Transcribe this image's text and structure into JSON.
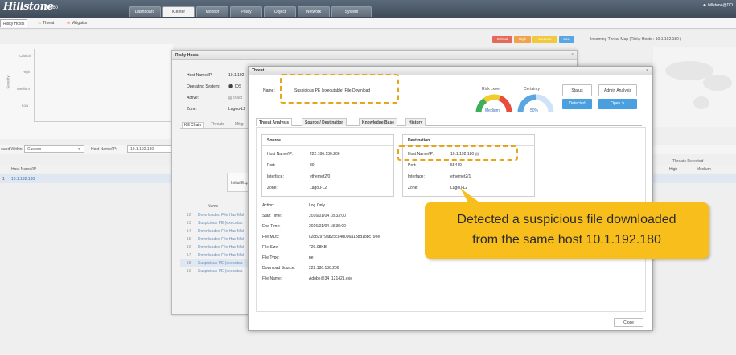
{
  "app": {
    "logo": "Hillstone",
    "logo_sub": "NETWORKS",
    "model": "T5060",
    "user": "hillstone@DO"
  },
  "nav": {
    "tabs": [
      "Dashboard",
      "iCenter",
      "Monitor",
      "Policy",
      "Object",
      "Network",
      "System"
    ],
    "active": "iCenter"
  },
  "subnav": {
    "tabs": [
      "Risky Hosts",
      "Threat",
      "Mitigation"
    ]
  },
  "severity_tags": [
    {
      "label": "Critical",
      "color": "#e36a5a"
    },
    {
      "label": "High",
      "color": "#f1a24b"
    },
    {
      "label": "Medium",
      "color": "#f0ca3c"
    },
    {
      "label": "Low",
      "color": "#5aa6e3"
    }
  ],
  "map_title": "Incoming Threat Map (Risky Hosts : 10.1.192.180 )",
  "chart_axis": {
    "ylabel": "Severity",
    "levels": [
      "Critical",
      "High",
      "Medium",
      "Low"
    ]
  },
  "filter": {
    "label1": "ound Within:",
    "value1": "Custom",
    "label2": "Host Name/IP:",
    "value2": "10.1.192.180"
  },
  "host_table": {
    "header": "Host Name/IP",
    "row_index": "1",
    "row_value": "10.1.192.180",
    "threats_detected": "Threats Detected",
    "high": "High",
    "medium": "Medium"
  },
  "risky_window": {
    "title": "Risky Hosts",
    "host_label": "Host Name/IP:",
    "host_value": "10.1.192",
    "os_label": "Operating System:",
    "os_value": "IOS",
    "active_label": "Active:",
    "active_value": "Inact",
    "zone_label": "Zone:",
    "zone_value": "Lagou-L2",
    "tabs": [
      "Kill Chain",
      "Threats",
      "Mitig"
    ],
    "initial_label": "Initial Exp",
    "list_header": "Name",
    "list": [
      {
        "n": "12",
        "t": "Downloaded File Has Mal"
      },
      {
        "n": "13",
        "t": "Suspicious PE (executab"
      },
      {
        "n": "14",
        "t": "Downloaded File Has Mal"
      },
      {
        "n": "15",
        "t": "Downloaded File Has Mal"
      },
      {
        "n": "16",
        "t": "Downloaded File Has Mal"
      },
      {
        "n": "17",
        "t": "Downloaded File Has Mal"
      },
      {
        "n": "18",
        "t": "Suspicious PE (executab"
      },
      {
        "n": "19",
        "t": "Suspicious PE (executab"
      }
    ]
  },
  "threat": {
    "title": "Threat",
    "name_label": "Name:",
    "name_value": "Suspicious PE (executable) File Download",
    "risk_level_label": "Risk Level",
    "risk_level_value": "Medium",
    "certainty_label": "Certainty",
    "certainty_value": "50%",
    "certainty_fraction": 0.5,
    "status_label": "Status",
    "status_value": "Detected",
    "admin_label": "Admin Analysis",
    "admin_value": "Open",
    "tabs": [
      "Threat Analysis",
      "Source / Destination",
      "Knowledge Base",
      "History"
    ],
    "source": {
      "title": "Source",
      "host_label": "Host Name/IP:",
      "host_value": "222.186.130.206",
      "port_label": "Port:",
      "port_value": "80",
      "iface_label": "Interface:",
      "iface_value": "ethernet2/0",
      "zone_label": "Zone:",
      "zone_value": "Lagou-L2"
    },
    "destination": {
      "title": "Destination",
      "host_label": "Host Name/IP:",
      "host_value": "10.1.192.180",
      "port_label": "Port:",
      "port_value": "55449",
      "iface_label": "Interface:",
      "iface_value": "ethernet2/1",
      "zone_label": "Zone:",
      "zone_value": "Lagou-L2"
    },
    "details": [
      {
        "label": "Action:",
        "value": "Log Only"
      },
      {
        "label": "Start Time:",
        "value": "2016/01/04 18:33:00"
      },
      {
        "label": "End Time:",
        "value": "2016/01/04 18:38:00"
      },
      {
        "label": "File MD5:",
        "value": "c28b2979ab25ca4d096a138d18bc79ee"
      },
      {
        "label": "File Size:",
        "value": "729.08KB"
      },
      {
        "label": "File Type:",
        "value": "pe"
      },
      {
        "label": "Download Source:",
        "value": "222.186.130.206"
      },
      {
        "label": "File Name:",
        "value": "Adobe@34_121421.exe"
      }
    ],
    "close_label": "Close"
  },
  "callout": {
    "line1": "Detected a suspicious file downloaded",
    "line2": "from the same host 10.1.192.180"
  }
}
